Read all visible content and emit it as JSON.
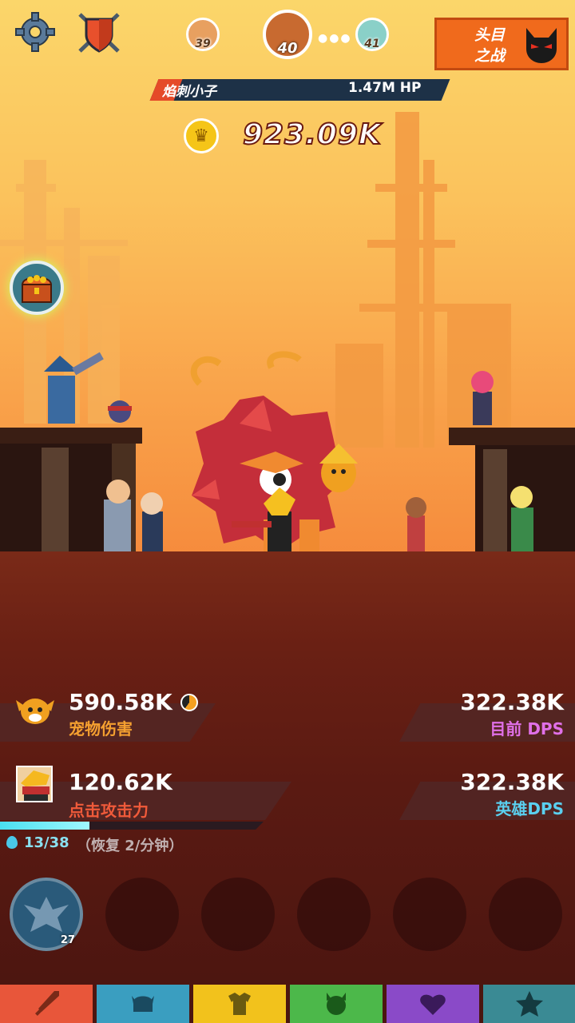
{
  "header": {
    "settings_icon": "gear-icon",
    "guild_icon": "shield-crossed-swords-icon",
    "stages": {
      "prev": "39",
      "current": "40",
      "next": "41"
    },
    "boss_button": {
      "line1": "头目",
      "line2": "之战"
    }
  },
  "enemy": {
    "name": "焰刺小子",
    "hp": "1.47M HP"
  },
  "currency": {
    "gold": "923.09K"
  },
  "stats": {
    "pet_damage": {
      "value": "590.58K",
      "label": "宠物伤害"
    },
    "current_dps": {
      "value": "322.38K",
      "label": "目前 DPS"
    },
    "tap_damage": {
      "value": "120.62K",
      "label": "点击攻击力"
    },
    "hero_dps": {
      "value": "322.38K",
      "label": "英雄DPS"
    }
  },
  "mana": {
    "current": "13/38",
    "regen": "（恢复 2/分钟）",
    "fill_fraction": 0.34
  },
  "skills": {
    "first_level": "27"
  },
  "bottom_tabs": [
    {
      "icon": "sword-icon",
      "color": "#e8563a"
    },
    {
      "icon": "helmet-icon",
      "color": "#3a9ec0"
    },
    {
      "icon": "armor-icon",
      "color": "#f2c21c"
    },
    {
      "icon": "pet-icon",
      "color": "#4cb84a"
    },
    {
      "icon": "heart-icon",
      "color": "#8a4ac8"
    },
    {
      "icon": "star-icon",
      "color": "#3a8a94"
    }
  ]
}
